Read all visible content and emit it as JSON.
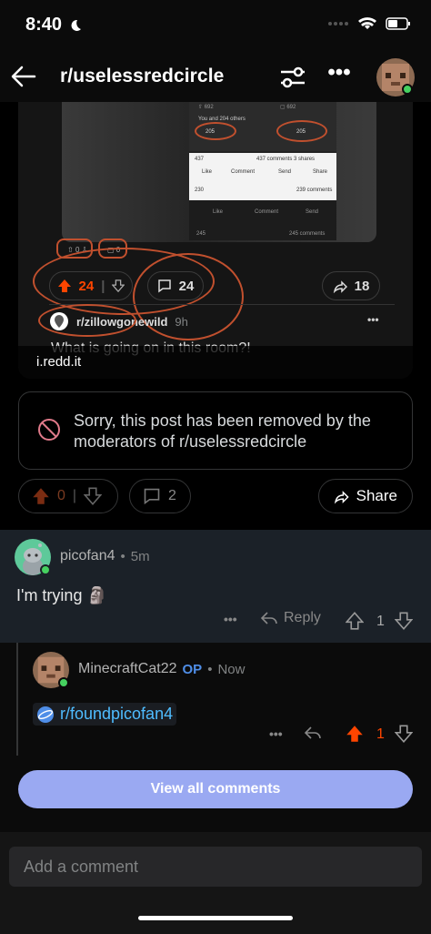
{
  "status_bar": {
    "time": "8:40"
  },
  "header": {
    "title": "r/uselessredcircle"
  },
  "image_post": {
    "embedded": {
      "votes_left": "692",
      "votes_right": "692",
      "you_and_others": "You and 204 others",
      "count_a": "205",
      "count_b": "205",
      "reactions": "437",
      "comments_shares": "437 comments 3 shares",
      "like": "Like",
      "comment": "Comment",
      "send": "Send",
      "share": "Share",
      "reactions2": "230",
      "comments2": "239 comments",
      "count_c": "245",
      "comments3": "245 comments",
      "mini_up": "0",
      "mini_cm": "0"
    },
    "inner_post": {
      "upvotes": "24",
      "comments": "24",
      "shares": "18",
      "subreddit": "r/zillowgonewild",
      "age": "9h",
      "title": "What is going on in this room?!"
    },
    "domain": "i.redd.it"
  },
  "removed_notice": {
    "text": "Sorry, this post has been removed by the moderators of r/uselessredcircle"
  },
  "post_actions": {
    "votes": "0",
    "comments": "2",
    "share_label": "Share"
  },
  "comments": [
    {
      "author": "picofan4",
      "age": "5m",
      "body": "I'm trying 🗿",
      "reply_label": "Reply",
      "votes": "1"
    },
    {
      "author": "MinecraftCat22",
      "op_badge": "OP",
      "age": "Now",
      "link_text": "r/foundpicofan4",
      "votes": "1"
    }
  ],
  "footer": {
    "view_all_label": "View all comments",
    "comment_placeholder": "Add a comment"
  },
  "colors": {
    "accent": "#ff4500",
    "view_all": "#9aa9f2",
    "circle": "#c1502e",
    "link": "#4fbcff"
  }
}
